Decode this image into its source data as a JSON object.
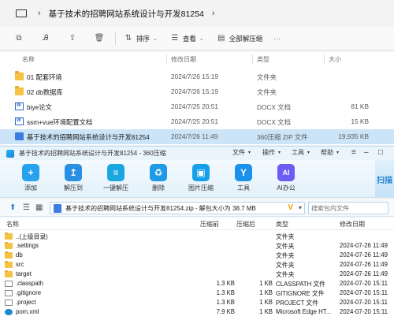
{
  "explorer": {
    "title": "基于技术的招聘网站系统设计与开发81254",
    "toolbar": {
      "sort": "排序",
      "view": "查看",
      "extract_all": "全部解压缩"
    },
    "columns": {
      "name": "名称",
      "date": "修改日期",
      "type": "类型",
      "size": "大小"
    },
    "rows": [
      {
        "name": "01 配套环境",
        "date": "2024/7/26 15:19",
        "type": "文件夹",
        "size": "",
        "icon": "folder-icon"
      },
      {
        "name": "02 db数据库",
        "date": "2024/7/26 15:19",
        "type": "文件夹",
        "size": "",
        "icon": "folder-icon"
      },
      {
        "name": "biye论文",
        "date": "2024/7/25 20:51",
        "type": "DOCX 文档",
        "size": "81 KB",
        "icon": "docx-icon"
      },
      {
        "name": "ssm+vue环境配置文档",
        "date": "2024/7/25 20:51",
        "type": "DOCX 文档",
        "size": "15 KB",
        "icon": "docx-icon"
      },
      {
        "name": "基于技术的招聘网站系统设计与开发81254",
        "date": "2024/7/26 11:49",
        "type": "360压缩 ZIP 文件",
        "size": "19,935 KB",
        "icon": "zip-icon"
      }
    ]
  },
  "zip": {
    "window_title": "基于技术的招聘网站系统设计与开发81254 - 360压缩",
    "menu": {
      "file": "文件",
      "op": "操作",
      "tools": "工具",
      "help": "帮助"
    },
    "buttons": [
      {
        "label": "添加",
        "color": "#27a3ee",
        "glyph": "+"
      },
      {
        "label": "解压到",
        "color": "#2a8fe3",
        "glyph": "↥"
      },
      {
        "label": "一键解压",
        "color": "#1aa6df",
        "glyph": "≡"
      },
      {
        "label": "删除",
        "color": "#1e9ae6",
        "glyph": "♻"
      },
      {
        "label": "图片压缩",
        "color": "#17a0e8",
        "glyph": "▣"
      },
      {
        "label": "工具",
        "color": "#1a91ea",
        "glyph": "Y"
      },
      {
        "label": "AI办公",
        "color": "#6c5cf2",
        "glyph": "AI"
      }
    ],
    "scan_label": "扫描",
    "address": "基于技术的招聘网站系统设计与开发81254.zip - 解包大小为 38.7 MB",
    "search_placeholder": "搜索包内文件",
    "columns": {
      "name": "名称",
      "compressed": "压缩前",
      "compressed_after": "压缩后",
      "type": "类型",
      "date": "修改日期"
    },
    "rows": [
      {
        "name": "..(上级目录)",
        "size_before": "",
        "size_after": "",
        "type": "文件夹",
        "date": "",
        "icon": "folder-icon"
      },
      {
        "name": ".settings",
        "size_before": "",
        "size_after": "",
        "type": "文件夹",
        "date": "2024-07-26 11:49",
        "icon": "folder-icon"
      },
      {
        "name": "db",
        "size_before": "",
        "size_after": "",
        "type": "文件夹",
        "date": "2024-07-26 11:49",
        "icon": "folder-icon"
      },
      {
        "name": "src",
        "size_before": "",
        "size_after": "",
        "type": "文件夹",
        "date": "2024-07-26 11:49",
        "icon": "folder-icon"
      },
      {
        "name": "target",
        "size_before": "",
        "size_after": "",
        "type": "文件夹",
        "date": "2024-07-26 11:49",
        "icon": "folder-icon"
      },
      {
        "name": ".classpath",
        "size_before": "1.3 KB",
        "size_after": "1 KB",
        "type": "CLASSPATH 文件",
        "date": "2024-07-20 15:11",
        "icon": "file-icon"
      },
      {
        "name": ".gitignore",
        "size_before": "1.3 KB",
        "size_after": "1 KB",
        "type": "GITIGNORE 文件",
        "date": "2024-07-20 15:11",
        "icon": "file-icon"
      },
      {
        "name": ".project",
        "size_before": "1.3 KB",
        "size_after": "1 KB",
        "type": "PROJECT 文件",
        "date": "2024-07-20 15:11",
        "icon": "file-icon"
      },
      {
        "name": "pom.xml",
        "size_before": "7.9 KB",
        "size_after": "1 KB",
        "type": "Microsoft Edge HT...",
        "date": "2024-07-20 15:11",
        "icon": "edge-icon"
      }
    ]
  }
}
